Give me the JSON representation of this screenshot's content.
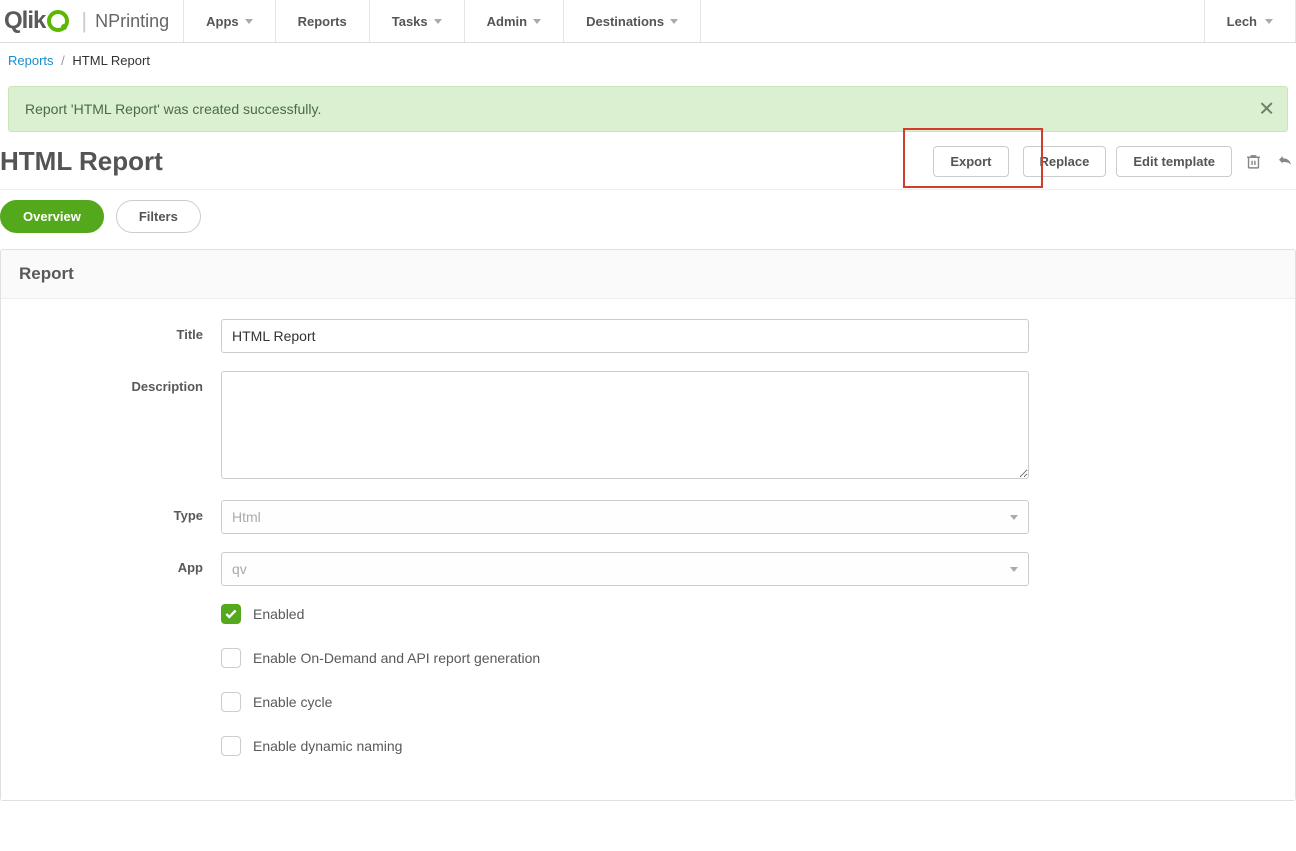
{
  "brand": {
    "qlik": "Qlik",
    "product": "NPrinting"
  },
  "nav": {
    "apps": "Apps",
    "reports": "Reports",
    "tasks": "Tasks",
    "admin": "Admin",
    "destinations": "Destinations"
  },
  "user": {
    "name": "Lech"
  },
  "breadcrumb": {
    "parent": "Reports",
    "current": "HTML Report"
  },
  "alert": {
    "message": "Report 'HTML Report' was created successfully."
  },
  "page": {
    "title": "HTML Report"
  },
  "actions": {
    "export": "Export",
    "replace": "Replace",
    "edit_template": "Edit template"
  },
  "tabs": {
    "overview": "Overview",
    "filters": "Filters"
  },
  "panel": {
    "report_heading": "Report"
  },
  "form": {
    "title_label": "Title",
    "title_value": "HTML Report",
    "description_label": "Description",
    "description_value": "",
    "type_label": "Type",
    "type_value": "Html",
    "app_label": "App",
    "app_value": "qv",
    "enabled_label": "Enabled",
    "ondemand_label": "Enable On-Demand and API report generation",
    "cycle_label": "Enable cycle",
    "dynamic_label": "Enable dynamic naming"
  }
}
